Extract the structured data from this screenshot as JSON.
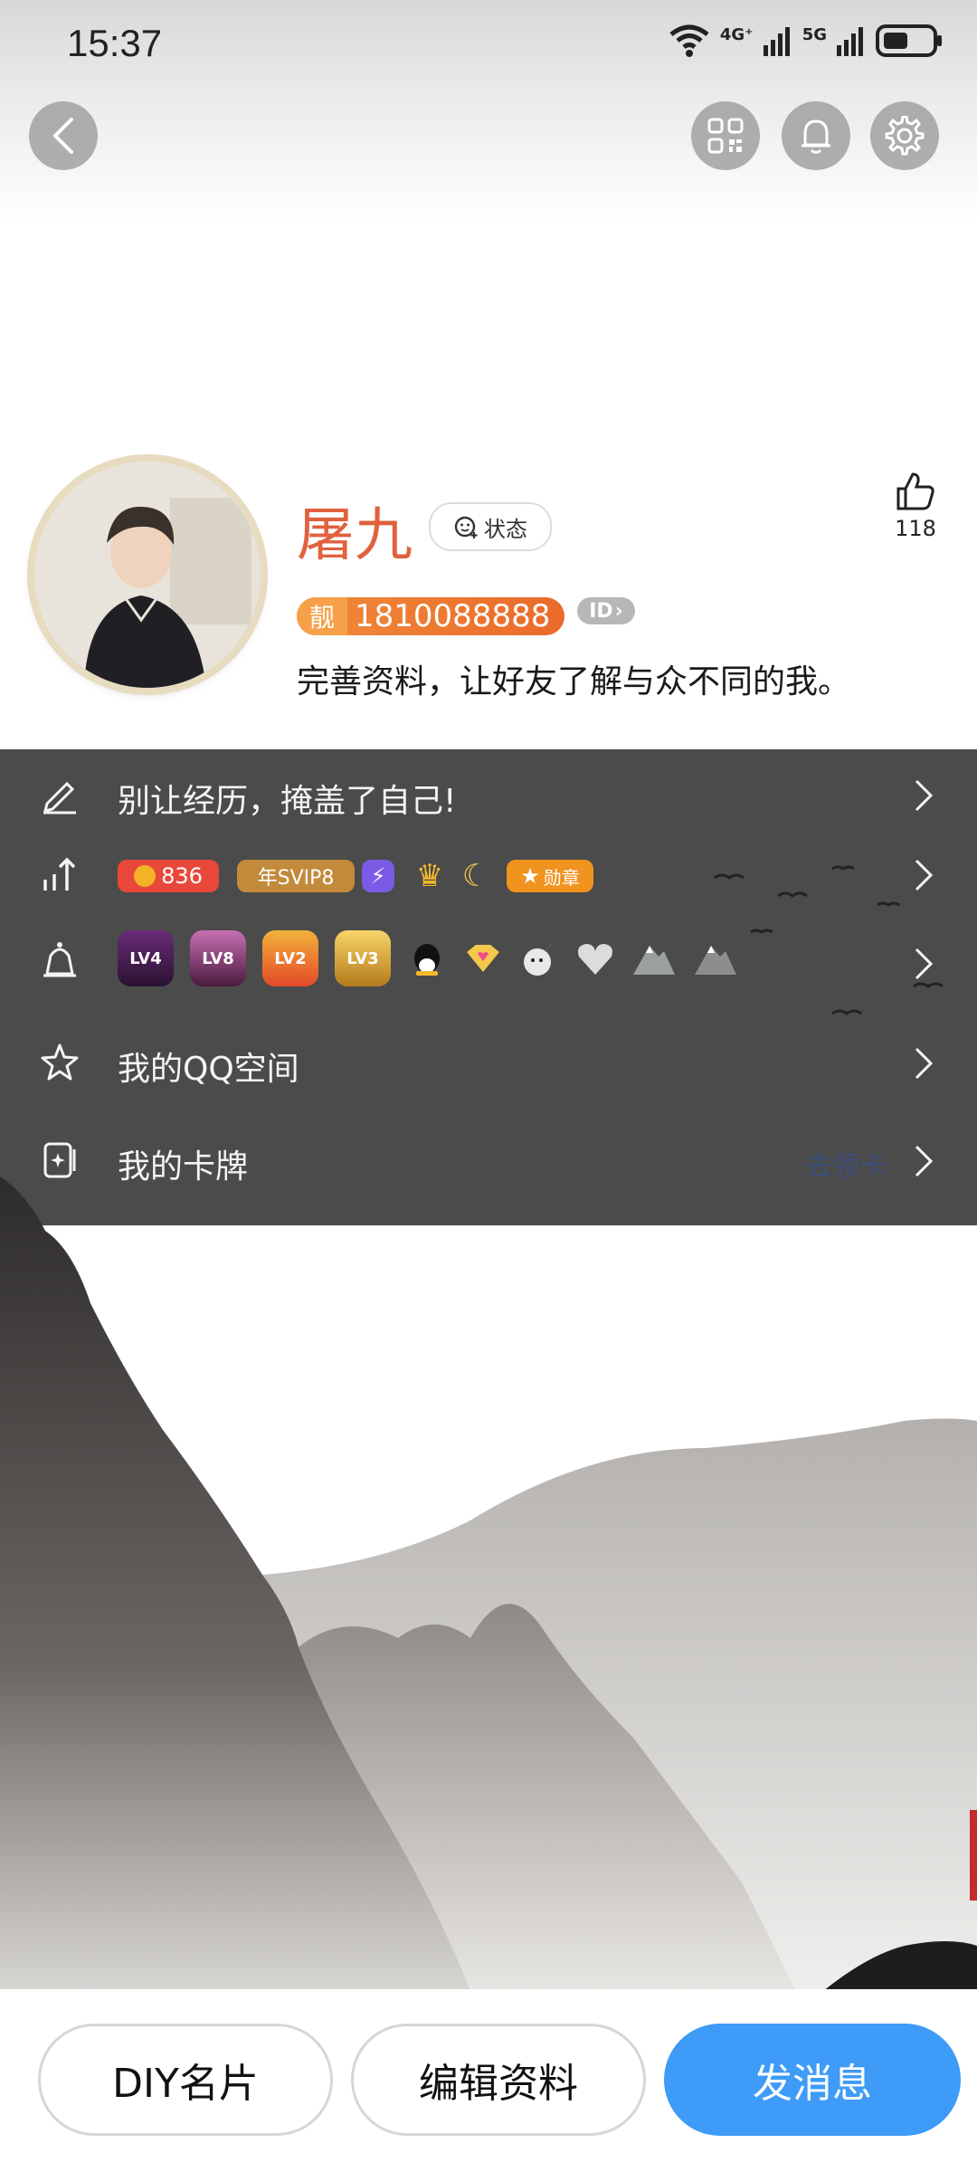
{
  "status_bar": {
    "time": "15:37",
    "net1": "4G⁺",
    "net2": "5G"
  },
  "header": {
    "back_icon": "chevron-left-icon",
    "qr_icon": "qr-code-icon",
    "bell_icon": "bell-icon",
    "settings_icon": "gear-icon"
  },
  "profile": {
    "name": "屠九",
    "status_label": "状态",
    "likes": "118",
    "qq_tag": "靓",
    "qq_number": "1810088888",
    "id_badge": "ID",
    "bio": "完善资料，让好友了解与众不同的我。"
  },
  "rows": {
    "experience": {
      "label": "别让经历，掩盖了自己!"
    },
    "level": {
      "coins": "836",
      "svip": "年SVIP8",
      "medal": "勋章"
    },
    "badges": {
      "items": [
        "LV4",
        "LV8",
        "LV2",
        "LV3"
      ]
    },
    "qzone": {
      "label": "我的QQ空间"
    },
    "cards": {
      "label": "我的卡牌",
      "hint": "去领卡"
    }
  },
  "actions": {
    "diy": "DIY名片",
    "edit": "编辑资料",
    "message": "发消息"
  },
  "colors": {
    "name": "#e0623f",
    "primary": "#3e9bf7",
    "panel": "#4b4b4b"
  }
}
